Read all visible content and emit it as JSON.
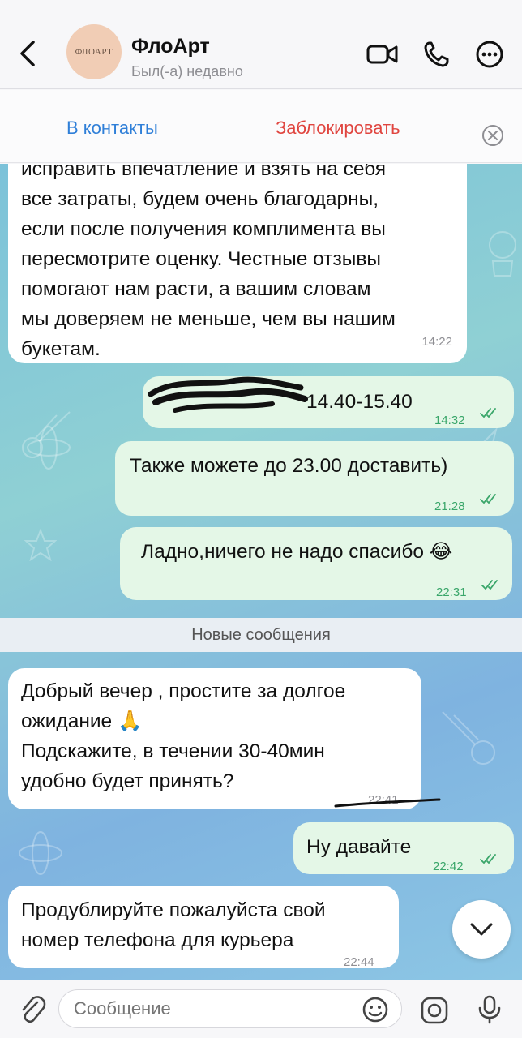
{
  "header": {
    "avatar_text": "ФЛОАРТ",
    "name": "ФлоАрт",
    "status": "Был(-а) недавно"
  },
  "action_bar": {
    "contacts": "В контакты",
    "block": "Заблокировать"
  },
  "messages": [
    {
      "dir": "in",
      "text": "исправить впечатление и взять на себя\nвсе затраты, будем очень благодарны,\nесли после получения комплимента вы\nпересмотрите оценку. Честные отзывы\nпомогают нам расти, а вашим словам\nмы доверяем не меньше, чем вы нашим\nбукетам.",
      "time": "14:22"
    },
    {
      "dir": "out",
      "text": "14.40-15.40",
      "time": "14:32",
      "read": true
    },
    {
      "dir": "out",
      "text": "Также можете до 23.00 доставить)",
      "time": "21:28",
      "read": true
    },
    {
      "dir": "out",
      "text": "Ладно,ничего не надо спасибо 😂",
      "time": "22:31",
      "read": true
    },
    {
      "dir": "in",
      "text": "Добрый вечер , простите за долгое\nожидание 🙏\nПодскажите, в течении 30-40мин\nудобно будет принять?",
      "time": "22:41"
    },
    {
      "dir": "out",
      "text": "Ну давайте",
      "time": "22:42",
      "read": true
    },
    {
      "dir": "in",
      "text": "Продублируйте пожалуйста свой\nномер телефона для курьера",
      "time": "22:44"
    }
  ],
  "new_messages_label": "Новые сообщения",
  "input": {
    "placeholder": "Сообщение"
  },
  "colors": {
    "accent": "#2f7fd8",
    "danger": "#e0453f",
    "outgoing_bubble": "#e4f7e7",
    "incoming_bubble": "#ffffff"
  },
  "icons": [
    "back-chevron-icon",
    "video-call-icon",
    "phone-icon",
    "more-icon",
    "close-circle-icon",
    "double-check-icon",
    "chevron-down-icon",
    "paperclip-icon",
    "sticker-icon",
    "camera-icon",
    "microphone-icon"
  ]
}
